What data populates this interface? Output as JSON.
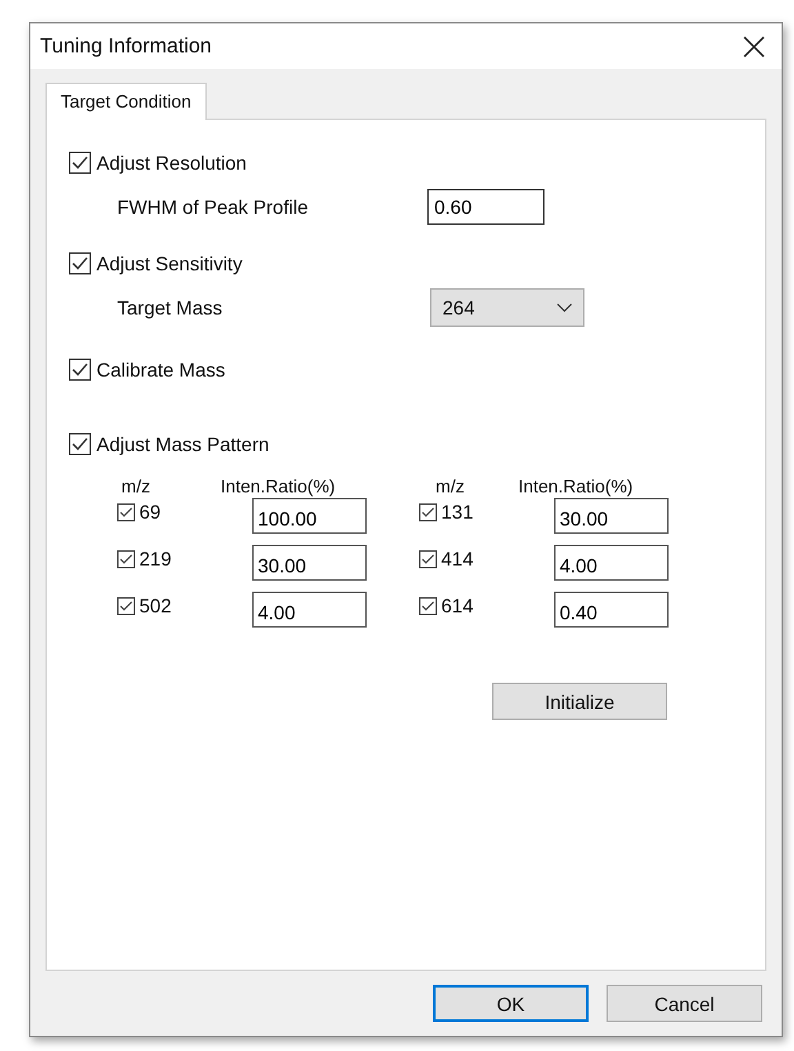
{
  "window": {
    "title": "Tuning Information"
  },
  "tabs": [
    {
      "label": "Target Condition",
      "selected": true
    }
  ],
  "options": [
    {
      "kind": "number",
      "label": "Adjust Resolution",
      "checked": true,
      "field": {
        "label": "FWHM of Peak Profile",
        "value": "0.60"
      }
    },
    {
      "kind": "dropdown",
      "label": "Adjust Sensitivity",
      "checked": true,
      "field": {
        "label": "Target Mass",
        "value": "264"
      }
    },
    {
      "kind": "plain",
      "label": "Calibrate Mass",
      "checked": true
    },
    {
      "kind": "pattern",
      "label": "Adjust Mass Pattern",
      "checked": true
    }
  ],
  "mass_pattern": {
    "groups": [
      {
        "mz_header": "m/z",
        "ratio_header": "Inten.Ratio(%)",
        "rows": [
          {
            "mz": "69",
            "checked": true,
            "ratio": "100.00"
          },
          {
            "mz": "219",
            "checked": true,
            "ratio": "30.00"
          },
          {
            "mz": "502",
            "checked": true,
            "ratio": "4.00"
          }
        ]
      },
      {
        "mz_header": "m/z",
        "ratio_header": "Inten.Ratio(%)",
        "rows": [
          {
            "mz": "131",
            "checked": true,
            "ratio": "30.00"
          },
          {
            "mz": "414",
            "checked": true,
            "ratio": "4.00"
          },
          {
            "mz": "614",
            "checked": true,
            "ratio": "0.40"
          }
        ]
      }
    ]
  },
  "initialize_button": "Initialize",
  "buttons": [
    {
      "label": "OK",
      "default": true
    },
    {
      "label": "Cancel",
      "default": false
    }
  ]
}
